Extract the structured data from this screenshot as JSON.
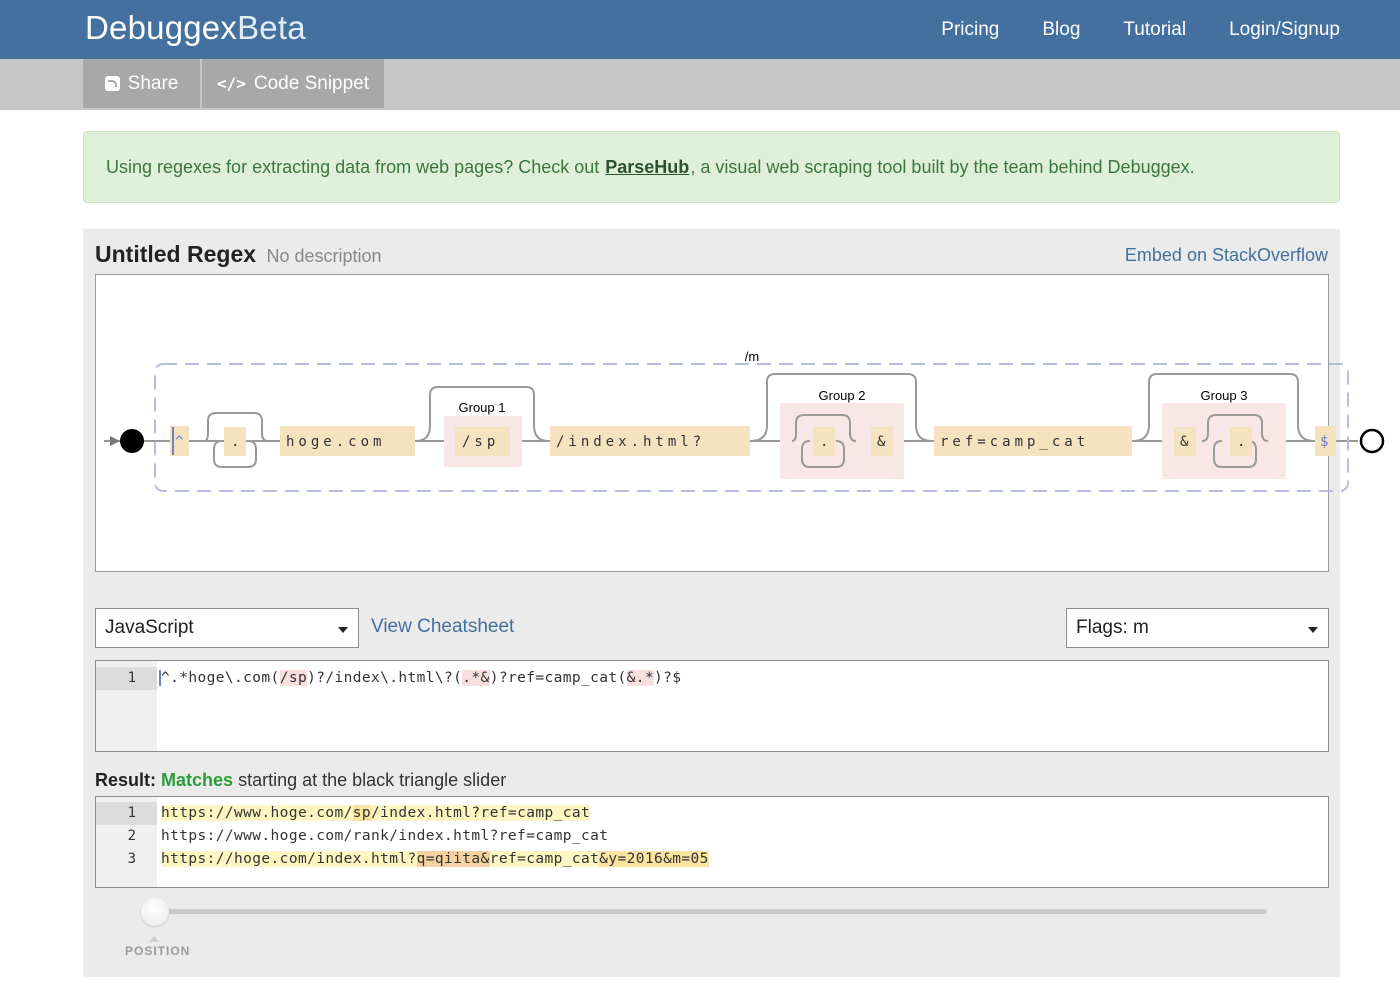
{
  "brand": {
    "main": "Debuggex",
    "suffix": "Beta"
  },
  "nav": {
    "pricing": "Pricing",
    "blog": "Blog",
    "tutorial": "Tutorial",
    "login": "Login/Signup"
  },
  "toolbar": {
    "share_label": "Share",
    "snippet_label": "Code Snippet",
    "snippet_glyph": "</>"
  },
  "alert": {
    "before": "Using regexes for extracting data from web pages? Check out ",
    "link": "ParseHub",
    "after": ", a visual web scraping tool built by the team behind Debuggex."
  },
  "regex_header": {
    "title": "Untitled Regex",
    "description": "No description",
    "embed_link": "Embed on StackOverflow"
  },
  "diagram": {
    "flag_label": "/m",
    "caret": "^",
    "dot1": ".",
    "host": "hoge.com",
    "group1_label": "Group 1",
    "group1_text": "/sp",
    "path": "/index.html?",
    "group2_label": "Group 2",
    "group2_dot": ".",
    "group2_amp": "&",
    "ref": "ref=camp_cat",
    "group3_label": "Group 3",
    "group3_amp": "&",
    "group3_dot": ".",
    "dollar": "$"
  },
  "language": {
    "selected": "JavaScript"
  },
  "cheatsheet_link": "View Cheatsheet",
  "flags": {
    "selected": "Flags: m"
  },
  "regex_editor": {
    "line_number": "1",
    "part1": "^.*hoge\\.com(",
    "grp1": "/sp",
    "part2": ")?/index\\.html\\?(",
    "grp2": ".*&",
    "part3": ")?ref=camp_cat(",
    "grp3": "&.*",
    "part4": ")?$"
  },
  "result": {
    "label": "Result:",
    "status": "Matches",
    "detail": " starting at the black triangle slider"
  },
  "test_lines": [
    {
      "num": "1",
      "a": "https://www.hoge.com/",
      "b": "sp",
      "c": "/index.html?ref=camp_cat"
    },
    {
      "num": "2",
      "text": "https://www.hoge.com/rank/index.html?ref=camp_cat"
    },
    {
      "num": "3",
      "a": "https://hoge.com/index.html?",
      "b": "q=qiita&",
      "c": "ref=camp_cat",
      "d": "&y=2016&m=05"
    }
  ],
  "slider": {
    "label": "POSITION"
  },
  "colors": {
    "nav": "#43709e",
    "subbar": "#c6c6c6",
    "alert_bg": "#dff0d8",
    "token_bg": "#f5e3bf",
    "group_bg": "#f9e7e7",
    "match_ok": "#2b9e3a"
  }
}
